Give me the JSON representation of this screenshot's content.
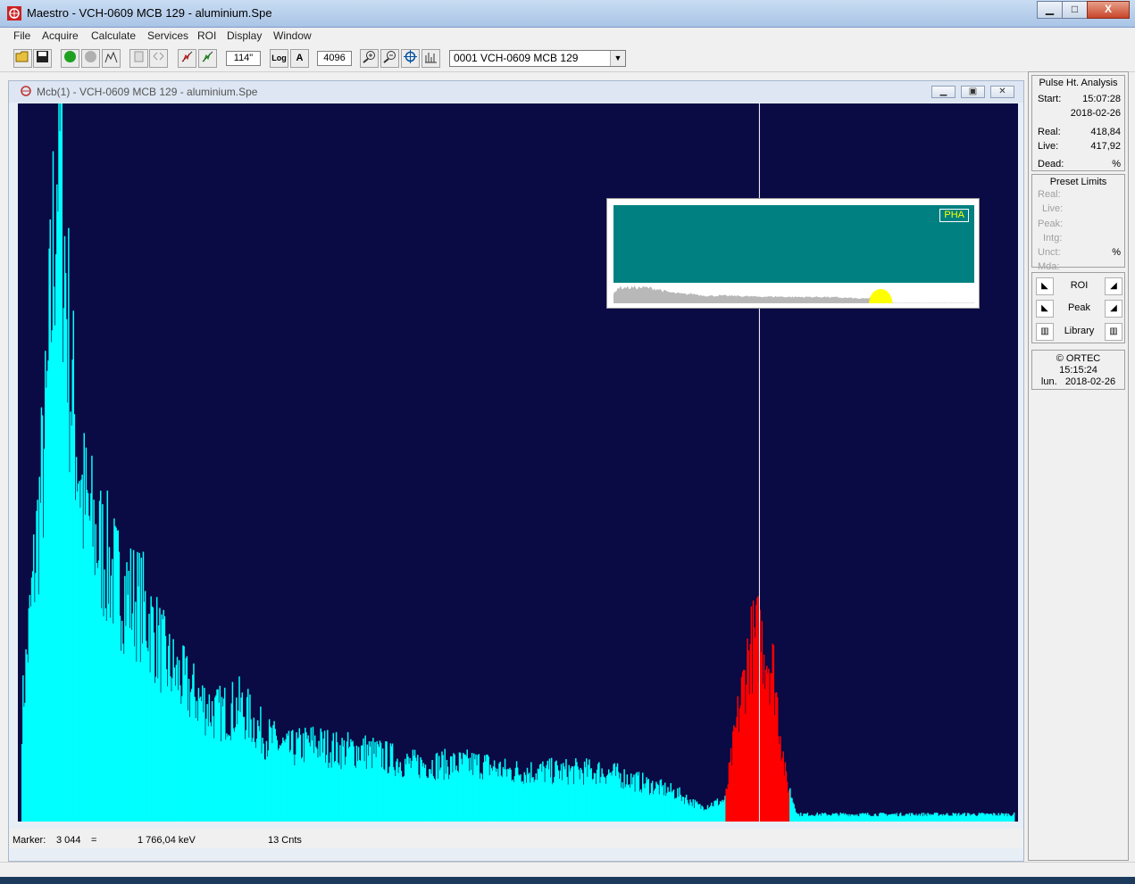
{
  "app": {
    "title": "Maestro - VCH-0609 MCB 129 - aluminium.Spe",
    "window_buttons": {
      "minimize": "▁",
      "maximize": "□",
      "close": "X"
    }
  },
  "menu": [
    "File",
    "Acquire",
    "Calculate",
    "Services",
    "ROI",
    "Display",
    "Window"
  ],
  "toolbar": {
    "vertical_scale": "114\"",
    "log_button": "Log",
    "auto_button": "A",
    "horizontal_scale": "4096",
    "detector": "0001  VCH-0609 MCB 129",
    "icons": [
      "open-icon",
      "save-icon",
      "start-icon",
      "stop-icon",
      "clear-icon",
      "copy-buffer-icon",
      "detector-buffer-icon",
      "roi-mark-icon",
      "roi-unmark-icon",
      "zoom-in-icon",
      "zoom-out-icon",
      "center-icon",
      "full-view-icon"
    ]
  },
  "spectrum_window": {
    "title": "Mcb(1) - VCH-0609 MCB 129 - aluminium.Spe",
    "buttons": {
      "minimize": "▁",
      "restore": "▣",
      "close": "✕"
    },
    "overview_badge": "PHA",
    "marker": {
      "label": "Marker:",
      "channel": "3 044",
      "equals": "=",
      "energy": "1 766,04  keV",
      "counts": "13  Cnts"
    }
  },
  "chart_data": {
    "type": "area",
    "xlim": [
      0,
      4096
    ],
    "marker_channel": 3044,
    "roi": [
      2904,
      3164
    ],
    "colors": {
      "background": "#0a0a44",
      "spectrum": "#00ffff",
      "roi": "#ff0000",
      "marker": "#ffffff"
    },
    "series": [
      {
        "x": [
          0,
          100,
          150,
          200,
          250,
          300,
          400,
          500,
          600,
          700,
          800,
          900,
          1000,
          1100,
          1200,
          1300,
          1400,
          1500,
          1600,
          1700,
          1800,
          1900,
          2000,
          2100,
          2200,
          2300,
          2400,
          2500,
          2600,
          2700,
          2800,
          2900,
          2950,
          3000,
          3044,
          3100,
          3150,
          3200,
          3300,
          3400,
          3500,
          3600,
          3700,
          3800,
          3900,
          4000,
          4096
        ],
        "values": [
          0.15,
          0.55,
          0.98,
          0.62,
          0.45,
          0.4,
          0.33,
          0.3,
          0.22,
          0.18,
          0.15,
          0.16,
          0.12,
          0.1,
          0.11,
          0.1,
          0.1,
          0.09,
          0.08,
          0.08,
          0.08,
          0.08,
          0.07,
          0.07,
          0.07,
          0.07,
          0.07,
          0.06,
          0.05,
          0.04,
          0.02,
          0.03,
          0.14,
          0.24,
          0.26,
          0.21,
          0.06,
          0.01,
          0.01,
          0.01,
          0.01,
          0.01,
          0.01,
          0.01,
          0.01,
          0.01,
          0.01
        ]
      }
    ]
  },
  "side": {
    "pulse_title": "Pulse Ht. Analysis",
    "start_label": "Start:",
    "start_time": "15:07:28",
    "start_date": "2018-02-26",
    "real_label": "Real:",
    "real_value": "418,84",
    "live_label": "Live:",
    "live_value": "417,92",
    "dead_label": "Dead:",
    "dead_value": "%",
    "preset_title": "Preset Limits",
    "preset_real": "Real:",
    "preset_live": "Live:",
    "preset_peak": "Peak:",
    "preset_intg": "Intg:",
    "preset_unct": "Unct:",
    "preset_unct_value": "%",
    "preset_mda": "Mda:",
    "nav_roi": "ROI",
    "nav_peak": "Peak",
    "nav_library": "Library",
    "copyright": "© ORTEC",
    "clock_time": "15:15:24",
    "clock_day": "lun.",
    "clock_date": "2018-02-26"
  }
}
